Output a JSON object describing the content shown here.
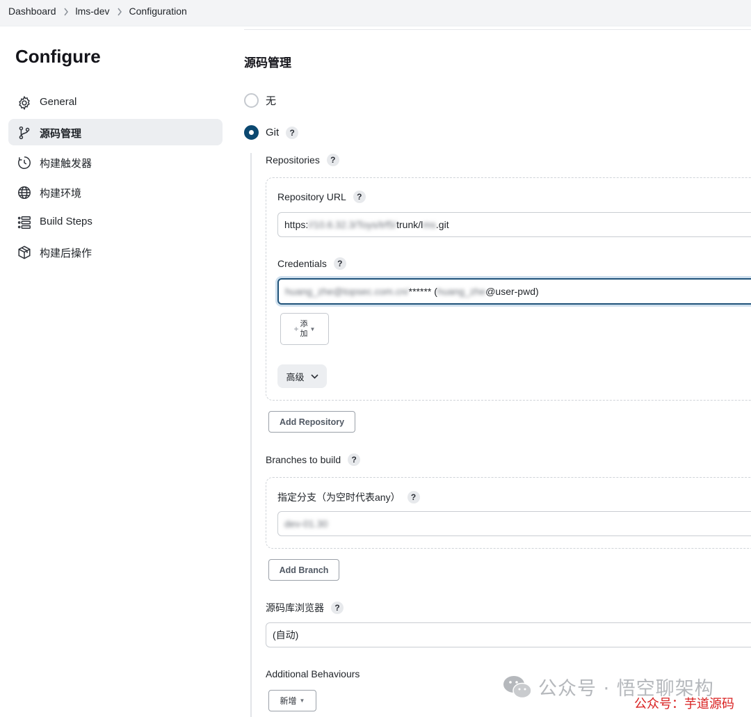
{
  "breadcrumb": [
    "Dashboard",
    "lms-dev",
    "Configuration"
  ],
  "sidebar": {
    "title": "Configure",
    "items": [
      {
        "label": "General",
        "icon": "gear-icon",
        "active": false
      },
      {
        "label": "源码管理",
        "icon": "git-branch-icon",
        "active": true
      },
      {
        "label": "构建触发器",
        "icon": "clock-icon",
        "active": false
      },
      {
        "label": "构建环境",
        "icon": "globe-icon",
        "active": false
      },
      {
        "label": "Build Steps",
        "icon": "list-icon",
        "active": false
      },
      {
        "label": "构建后操作",
        "icon": "package-icon",
        "active": false
      }
    ]
  },
  "scm": {
    "title": "源码管理",
    "option_none": "无",
    "option_git": "Git",
    "selected": "Git",
    "repositories_label": "Repositories",
    "repository_url_label": "Repository URL",
    "repository_url_prefix": "https:",
    "repository_url_blurred_host": "//10.6.32.3/Toys/trf5/",
    "repository_url_path": "trunk/l",
    "repository_url_blurred_name": "ms",
    "repository_url_suffix": ".git",
    "credentials_label": "Credentials",
    "credentials_blurred_email": "huang_zhe@topsec.com.cn/",
    "credentials_mask": "****** (",
    "credentials_blurred_user": "huang_zhe",
    "credentials_suffix": "@user-pwd)",
    "add_button_line1": "添",
    "add_button_line2": "加",
    "advanced_label": "高级",
    "add_repository": "Add Repository",
    "branches_label": "Branches to build",
    "branch_specifier_label": "指定分支（为空时代表any）",
    "branch_value_blurred": "dev-01.30",
    "add_branch": "Add Branch",
    "browser_label": "源码库浏览器",
    "browser_value": "(自动)",
    "additional_behaviours_label": "Additional Behaviours",
    "new_button": "新增"
  },
  "watermark": {
    "text": "公众号 · 悟空聊架构",
    "red_text": "公众号：芋道源码"
  },
  "colors": {
    "accent": "#0b4870",
    "active_bg": "#eceef1",
    "watermark_red": "#d92020"
  }
}
